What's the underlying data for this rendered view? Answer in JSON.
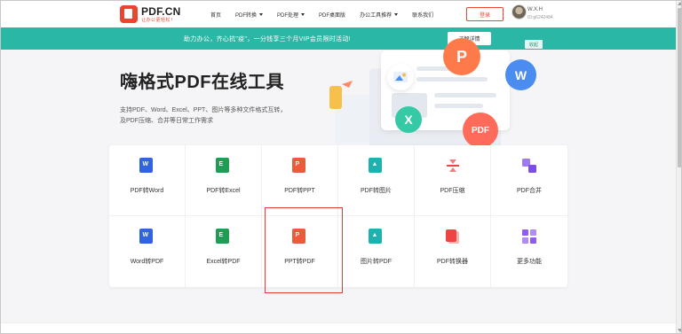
{
  "header": {
    "logo_title": "PDF.CN",
    "logo_subtitle": "让办公更轻松！",
    "nav": [
      {
        "label": "首页",
        "has_dropdown": false
      },
      {
        "label": "PDF转换",
        "has_dropdown": true
      },
      {
        "label": "PDF处理",
        "has_dropdown": true
      },
      {
        "label": "PDF桌面版",
        "has_dropdown": false
      },
      {
        "label": "办公工具推荐",
        "has_dropdown": true
      },
      {
        "label": "联系我们",
        "has_dropdown": false
      }
    ],
    "login_label": "登录",
    "user_name": "W.X.H",
    "user_id": "ID:g6242484"
  },
  "banner": {
    "text": "助力办公，齐心抗\"疫\"，一分钱享三个月VIP会员限时活动!",
    "button_label": "了解详情",
    "close_label": "收起",
    "color": "#2bb7a5"
  },
  "hero": {
    "title": "嗨格式PDF在线工具",
    "description": "支持PDF、Word、Excel、PPT、图片等多种文件格式互转，及PDF压缩、合并等日常工作需求"
  },
  "illustration": {
    "bubble_p": "P",
    "bubble_w": "W",
    "bubble_x": "X",
    "bubble_pdf": "PDF"
  },
  "tools": [
    {
      "label": "PDF转Word",
      "icon": "word-icon",
      "color": "#2f63e0",
      "glyph": "W"
    },
    {
      "label": "PDF转Excel",
      "icon": "excel-icon",
      "color": "#1f9d55",
      "glyph": "E"
    },
    {
      "label": "PDF转PPT",
      "icon": "ppt-icon",
      "color": "#ef5a3c",
      "glyph": "P"
    },
    {
      "label": "PDF转图片",
      "icon": "image-icon",
      "color": "#1fb0b0",
      "glyph": "▲"
    },
    {
      "label": "PDF压缩",
      "icon": "compress-icon",
      "color": "#ef4444",
      "glyph": ""
    },
    {
      "label": "PDF合并",
      "icon": "merge-icon",
      "color": "#7c4de8",
      "glyph": ""
    },
    {
      "label": "Word转PDF",
      "icon": "word-icon",
      "color": "#2f63e0",
      "glyph": "W"
    },
    {
      "label": "Excel转PDF",
      "icon": "excel-icon",
      "color": "#1f9d55",
      "glyph": "E"
    },
    {
      "label": "PPT转PDF",
      "icon": "ppt-icon",
      "color": "#ef5a3c",
      "glyph": "P"
    },
    {
      "label": "图片转PDF",
      "icon": "image-icon",
      "color": "#1fb0b0",
      "glyph": "▲"
    },
    {
      "label": "PDF转换器",
      "icon": "converter-icon",
      "color": "#ef4444",
      "glyph": ""
    },
    {
      "label": "更多功能",
      "icon": "grid-icon",
      "color": "#8e5cf0",
      "glyph": ""
    }
  ],
  "colors": {
    "brand": "#e8462f",
    "highlight": "#e03a3a"
  }
}
